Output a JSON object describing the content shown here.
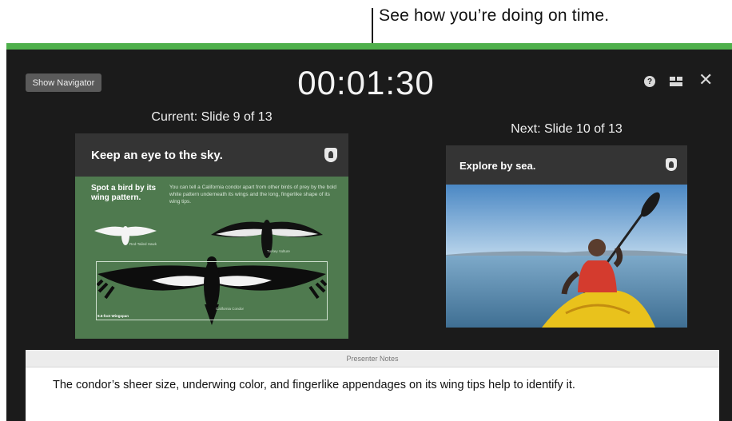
{
  "annotation": {
    "text": "See how you’re doing on time."
  },
  "toolbar": {
    "show_navigator": "Show Navigator",
    "timer": "00:01:30",
    "icons": [
      "help-icon",
      "layout-icon",
      "close-icon"
    ]
  },
  "current": {
    "label": "Current: Slide 9 of 13",
    "title": "Keep an eye to the sky.",
    "subhead": "Spot a bird by its wing pattern.",
    "body": "You can tell a California condor apart from other birds of prey by the bold white pattern underneath its wings and the long, fingerlike shape of its wing tips.",
    "bird_labels": [
      "Red-Tailed Hawk",
      "Turkey Vulture",
      "California Condor"
    ],
    "wingspan_label": "9.5-foot Wingspan"
  },
  "next": {
    "label": "Next: Slide 10 of 13",
    "title": "Explore by sea."
  },
  "notes": {
    "header": "Presenter Notes",
    "text": "The condor’s sheer size, underwing color, and fingerlike appendages on its wing tips help to identify it."
  },
  "colors": {
    "progress": "#4fb04c",
    "window_bg": "#1b1b1b",
    "slide_green": "#4f7a4f",
    "slide_header": "#343434"
  }
}
